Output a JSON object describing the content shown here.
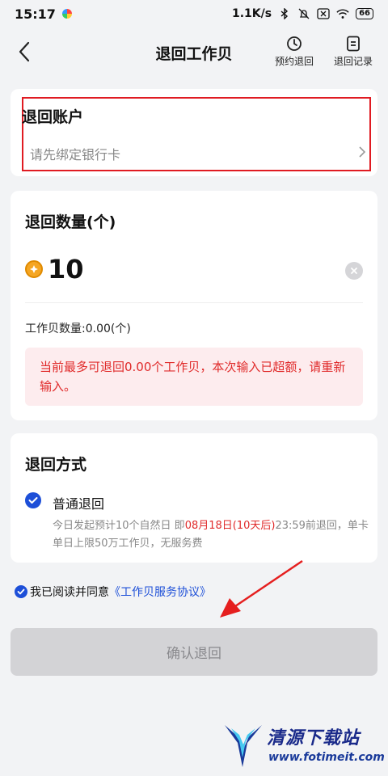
{
  "status_bar": {
    "time": "15:17",
    "speed": "1.1K/s",
    "battery": "66",
    "icons": [
      "app-icon",
      "bluetooth-icon",
      "mute-icon",
      "sim-off-icon",
      "wifi-icon",
      "battery-icon"
    ]
  },
  "nav": {
    "title": "退回工作贝",
    "back_icon": "back-chevron-icon",
    "schedule_label": "预约退回",
    "schedule_icon": "clock-icon",
    "records_label": "退回记录",
    "records_icon": "document-icon"
  },
  "account": {
    "title": "退回账户",
    "placeholder": "请先绑定银行卡",
    "highlight_color": "#e01b22"
  },
  "amount": {
    "title": "退回数量(个)",
    "value": "10",
    "balance_label": "工作贝数量:0.00(个)",
    "warning": "当前最多可退回0.00个工作贝，本次输入已超额，请重新输入。",
    "warning_color": "#e02a2a"
  },
  "method": {
    "title": "退回方式",
    "option_label": "普通退回",
    "option_selected": true,
    "desc_before": "今日发起预计10个自然日 即",
    "desc_highlight": "08月18日(10天后)",
    "desc_after": "23:59前退回，单卡单日上限50万工作贝，无服务费"
  },
  "agreement": {
    "prefix": "我已阅读并同意",
    "link": "《工作贝服务协议》",
    "checked": true
  },
  "confirm_button": {
    "label": "确认退回",
    "enabled": false
  },
  "watermark": {
    "title": "清源下载站",
    "url": "www.fotimeit.com"
  },
  "colors": {
    "accent": "#1d4fd8",
    "error": "#e02a2a",
    "background": "#f2f3f5"
  }
}
